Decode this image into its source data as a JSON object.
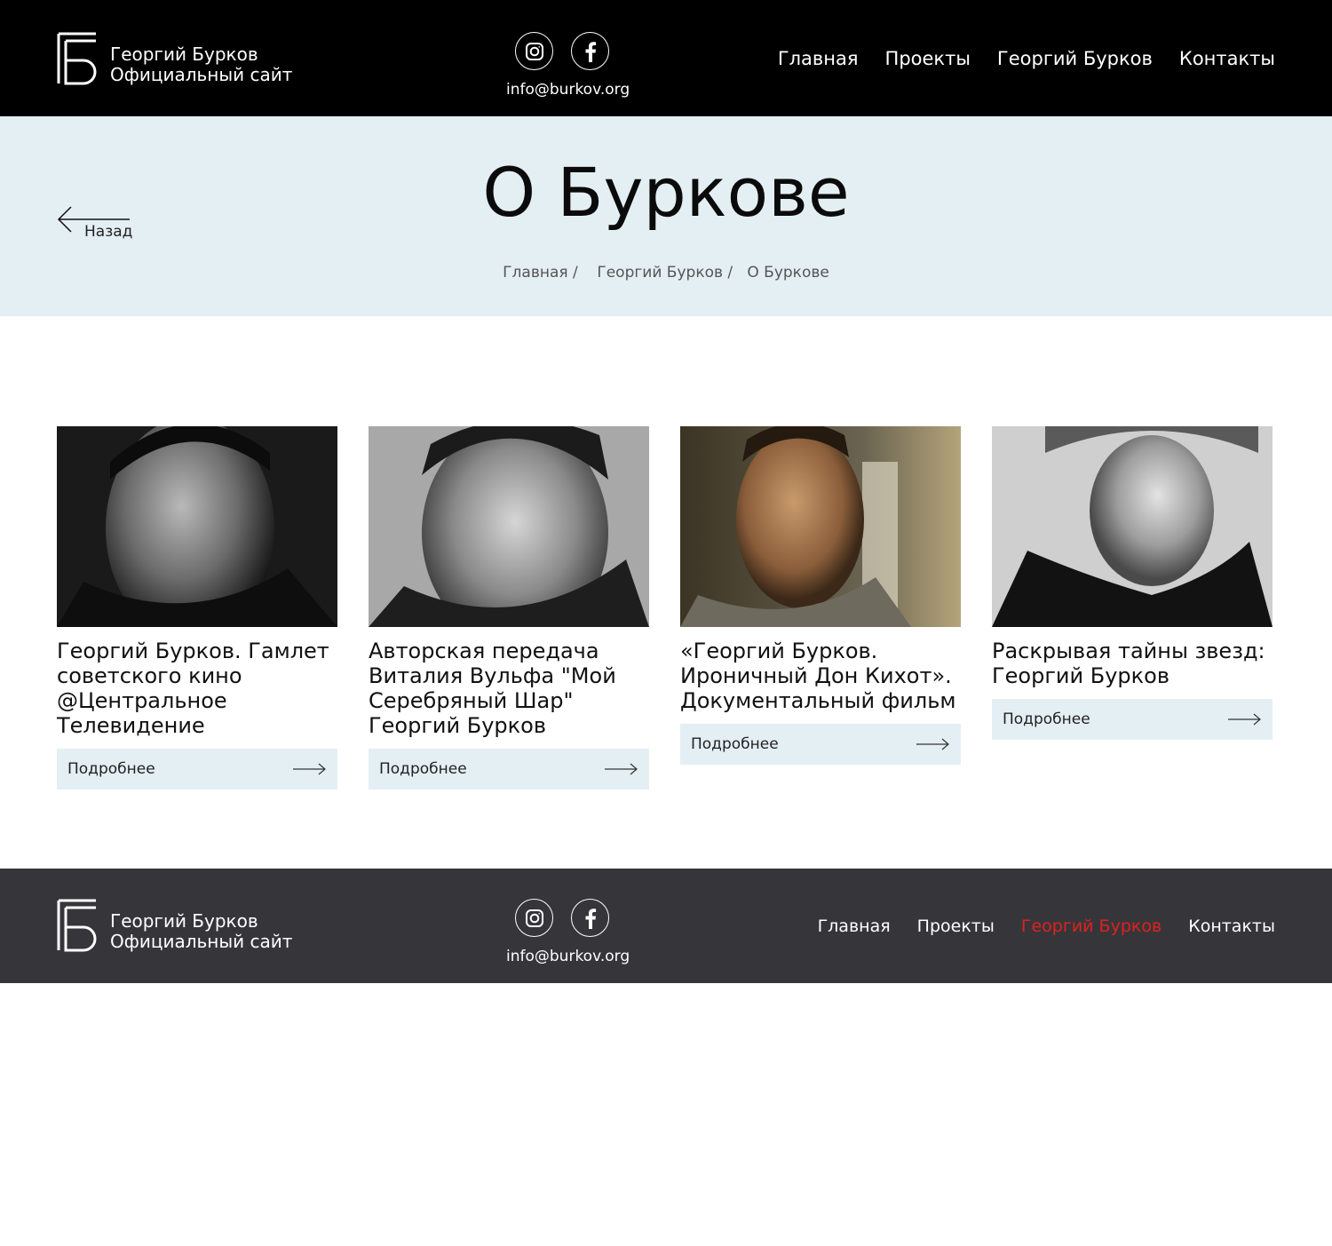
{
  "header": {
    "logo_line1": "Георгий Бурков",
    "logo_line2": "Официальный сайт",
    "email": "info@burkov.org",
    "nav": [
      "Главная",
      "Проекты",
      "Георгий Бурков",
      "Контакты"
    ]
  },
  "hero": {
    "back_label": "Назад",
    "title": "О Буркове",
    "breadcrumbs": [
      "Главная /",
      "Георгий Бурков /",
      "О Буркове"
    ]
  },
  "cards": [
    {
      "title": "Георгий Бурков. Гамлет советского кино @Центральное Телевидение",
      "more": "Подробнее"
    },
    {
      "title": "Авторская передача Виталия Вульфа \"Мой Серебряный Шар\" Георгий Бурков",
      "more": "Подробнее"
    },
    {
      "title": "«Георгий Бурков. Ироничный Дон Кихот». Документальный фильм",
      "more": "Подробнее"
    },
    {
      "title": "Раскрывая тайны звезд: Георгий Бурков",
      "more": "Подробнее"
    }
  ],
  "footer": {
    "logo_line1": "Георгий Бурков",
    "logo_line2": "Официальный сайт",
    "email": "info@burkov.org",
    "nav": [
      "Главная",
      "Проекты",
      "Георгий Бурков",
      "Контакты"
    ],
    "active_index": 2
  },
  "colors": {
    "header_bg": "#000000",
    "hero_bg": "#e4eff4",
    "footer_bg": "#36363a",
    "active_link": "#e0201f"
  },
  "icons": [
    "instagram-icon",
    "facebook-icon",
    "arrow-left-icon",
    "arrow-right-icon"
  ]
}
